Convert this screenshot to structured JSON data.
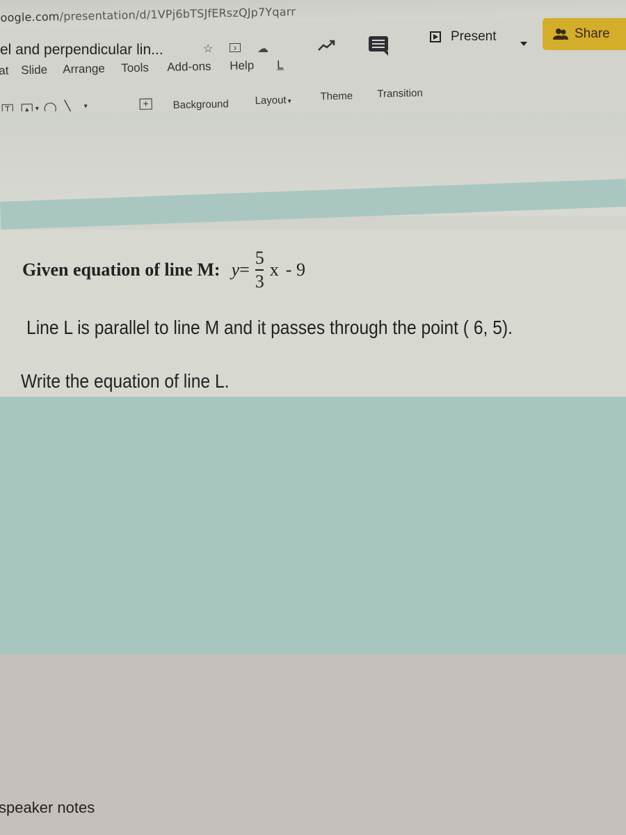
{
  "browser": {
    "url_host": "oogle.com",
    "url_path": "/presentation/d/1VPj6bTSJfERszQJp7Yqarr"
  },
  "document": {
    "title": "el and perpendicular lin...",
    "icons": [
      "star-icon",
      "move-to-folder-icon",
      "cloud-saved-icon"
    ]
  },
  "menu": {
    "items": [
      {
        "label": "at"
      },
      {
        "label": "Slide"
      },
      {
        "label": "Arrange"
      },
      {
        "label": "Tools"
      },
      {
        "label": "Add-ons"
      },
      {
        "label": "Help"
      },
      {
        "label": "L"
      }
    ]
  },
  "toolbar": {
    "background_label": "Background",
    "layout_label": "Layout",
    "theme_label": "Theme",
    "transition_label": "Transition"
  },
  "header_actions": {
    "present_label": "Present",
    "share_label": "Share",
    "share_color": "#d4ad2b"
  },
  "slide": {
    "equation_label": "Given equation of line  M:",
    "equation": {
      "lhs": "y",
      "equals": "=",
      "numerator": "5",
      "denominator": "3",
      "variable": "x",
      "constant": "- 9"
    },
    "line1": "Line L is parallel to line  M and it passes through the point  ( 6, 5).",
    "line2": "Write the equation of line L."
  },
  "notes": {
    "placeholder": "speaker notes"
  }
}
